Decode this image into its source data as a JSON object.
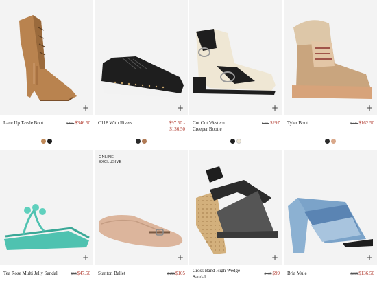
{
  "products": [
    {
      "name": "Lace Up Tassle Boot",
      "old_price": "$495",
      "price": "$346.50",
      "swatches": [
        "#c08a59",
        "#1e1e1e"
      ],
      "badge": ""
    },
    {
      "name": "C118 With Rivets",
      "old_price": "",
      "price": "$97.50 - $136.50",
      "swatches": [
        "#2a2a2a",
        "#b07a55"
      ],
      "badge": ""
    },
    {
      "name": "Cut Out Western Creeper Bootie",
      "old_price": "$495",
      "price": "$297",
      "swatches": [
        "#1e1e1e",
        "#efe7d4"
      ],
      "badge": ""
    },
    {
      "name": "Tyler Boot",
      "old_price": "$325",
      "price": "$162.50",
      "swatches": [
        "#2a2a2a",
        "#d9a88a"
      ],
      "badge": ""
    },
    {
      "name": "Tea Rose Multi Jelly Sandal",
      "old_price": "$95",
      "price": "$47.50",
      "swatches": [],
      "badge": ""
    },
    {
      "name": "Stanton Ballet",
      "old_price": "$150",
      "price": "$105",
      "swatches": [],
      "badge": "ONLINE EXCLUSIVE"
    },
    {
      "name": "Cross Band High Wedge Sandal",
      "old_price": "$165",
      "price": "$99",
      "swatches": [],
      "badge": ""
    },
    {
      "name": "Bria Mule",
      "old_price": "$295",
      "price": "$136.50",
      "swatches": [],
      "badge": ""
    }
  ],
  "badge_lines": [
    "ONLINE",
    "EXCLUSIVE"
  ],
  "add_symbol": "+",
  "colors": {
    "sale": "#b03a2e",
    "card_bg": "#f3f3f3"
  }
}
